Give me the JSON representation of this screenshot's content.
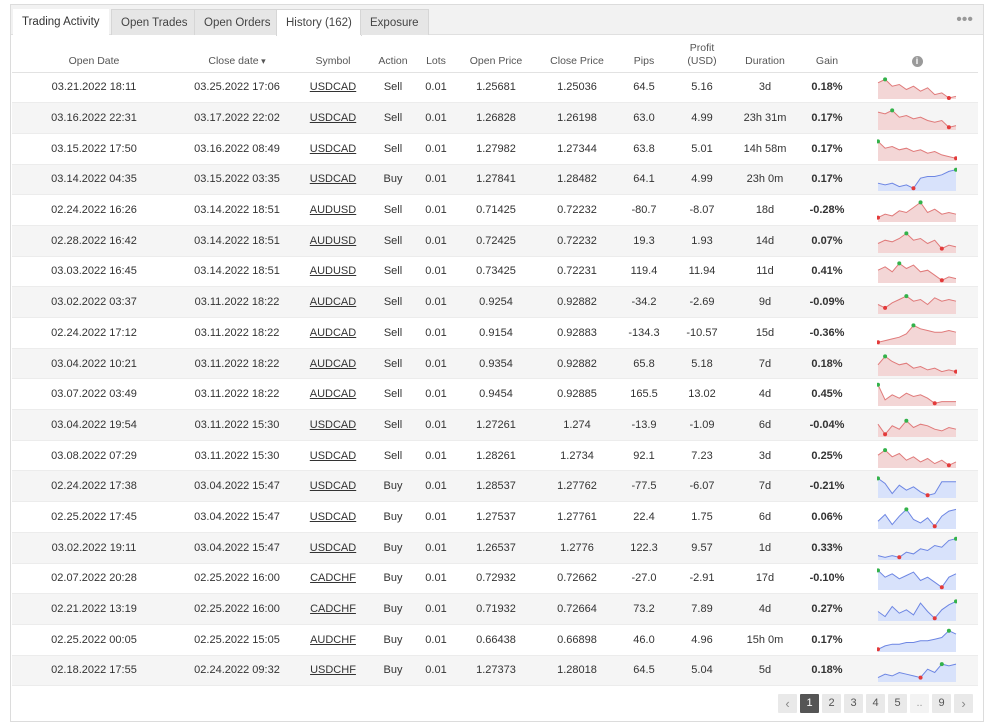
{
  "tabs": [
    {
      "label": "Trading Activity"
    },
    {
      "label": "Open Trades"
    },
    {
      "label": "Open Orders"
    },
    {
      "label": "History (162)"
    },
    {
      "label": "Exposure"
    }
  ],
  "more_icon": "ellipsis-icon",
  "columns": {
    "open_date": "Open Date",
    "close_date": "Close date",
    "symbol": "Symbol",
    "action": "Action",
    "lots": "Lots",
    "open_price": "Open Price",
    "close_price": "Close Price",
    "pips": "Pips",
    "profit_line1": "Profit",
    "profit_line2": "(USD)",
    "duration": "Duration",
    "gain": "Gain",
    "info": "i"
  },
  "rows": [
    {
      "open_date": "03.21.2022 18:11",
      "close_date": "03.25.2022 17:06",
      "symbol": "USDCAD",
      "action": "Sell",
      "lots": "0.01",
      "open_price": "1.25681",
      "close_price": "1.25036",
      "pips": "64.5",
      "profit": "5.16",
      "duration": "3d",
      "gain": "0.18%",
      "sign": "pos",
      "spark": {
        "kind": "sell",
        "pts": [
          4,
          2,
          6,
          5,
          8,
          6,
          9,
          7,
          11,
          10,
          13,
          12
        ]
      }
    },
    {
      "open_date": "03.16.2022 22:31",
      "close_date": "03.17.2022 22:02",
      "symbol": "USDCAD",
      "action": "Sell",
      "lots": "0.01",
      "open_price": "1.26828",
      "close_price": "1.26198",
      "pips": "63.0",
      "profit": "4.99",
      "duration": "23h 31m",
      "gain": "0.17%",
      "sign": "pos",
      "spark": {
        "kind": "sell",
        "pts": [
          3,
          4,
          2,
          6,
          5,
          7,
          6,
          8,
          9,
          8,
          12,
          11
        ]
      }
    },
    {
      "open_date": "03.15.2022 17:50",
      "close_date": "03.16.2022 08:49",
      "symbol": "USDCAD",
      "action": "Sell",
      "lots": "0.01",
      "open_price": "1.27982",
      "close_price": "1.27344",
      "pips": "63.8",
      "profit": "5.01",
      "duration": "14h 58m",
      "gain": "0.17%",
      "sign": "pos",
      "spark": {
        "kind": "sell",
        "pts": [
          2,
          6,
          5,
          7,
          6,
          8,
          7,
          9,
          8,
          10,
          11,
          12
        ]
      }
    },
    {
      "open_date": "03.14.2022 04:35",
      "close_date": "03.15.2022 03:35",
      "symbol": "USDCAD",
      "action": "Buy",
      "lots": "0.01",
      "open_price": "1.27841",
      "close_price": "1.28482",
      "pips": "64.1",
      "profit": "4.99",
      "duration": "23h 0m",
      "gain": "0.17%",
      "sign": "pos",
      "spark": {
        "kind": "buy",
        "pts": [
          9,
          10,
          9,
          11,
          10,
          12,
          6,
          5,
          5,
          4,
          2,
          1
        ]
      }
    },
    {
      "open_date": "02.24.2022 16:26",
      "close_date": "03.14.2022 18:51",
      "symbol": "AUDUSD",
      "action": "Sell",
      "lots": "0.01",
      "open_price": "0.71425",
      "close_price": "0.72232",
      "pips": "-80.7",
      "profit": "-8.07",
      "duration": "18d",
      "gain": "-0.28%",
      "sign": "neg",
      "spark": {
        "kind": "sell",
        "pts": [
          11,
          9,
          10,
          7,
          8,
          5,
          2,
          8,
          6,
          9,
          8,
          9
        ]
      }
    },
    {
      "open_date": "02.28.2022 16:42",
      "close_date": "03.14.2022 18:51",
      "symbol": "AUDUSD",
      "action": "Sell",
      "lots": "0.01",
      "open_price": "0.72425",
      "close_price": "0.72232",
      "pips": "19.3",
      "profit": "1.93",
      "duration": "14d",
      "gain": "0.07%",
      "sign": "pos",
      "spark": {
        "kind": "sell",
        "pts": [
          8,
          6,
          7,
          5,
          2,
          6,
          5,
          8,
          6,
          11,
          9,
          10
        ]
      }
    },
    {
      "open_date": "03.03.2022 16:45",
      "close_date": "03.14.2022 18:51",
      "symbol": "AUDUSD",
      "action": "Sell",
      "lots": "0.01",
      "open_price": "0.73425",
      "close_price": "0.72231",
      "pips": "119.4",
      "profit": "11.94",
      "duration": "11d",
      "gain": "0.41%",
      "sign": "pos",
      "spark": {
        "kind": "sell",
        "pts": [
          6,
          4,
          7,
          2,
          5,
          3,
          7,
          6,
          9,
          12,
          10,
          11
        ]
      }
    },
    {
      "open_date": "03.02.2022 03:37",
      "close_date": "03.11.2022 18:22",
      "symbol": "AUDCAD",
      "action": "Sell",
      "lots": "0.01",
      "open_price": "0.9254",
      "close_price": "0.92882",
      "pips": "-34.2",
      "profit": "-2.69",
      "duration": "9d",
      "gain": "-0.09%",
      "sign": "neg",
      "spark": {
        "kind": "sell",
        "pts": [
          8,
          10,
          7,
          5,
          3,
          6,
          5,
          8,
          4,
          6,
          5,
          6
        ]
      }
    },
    {
      "open_date": "02.24.2022 17:12",
      "close_date": "03.11.2022 18:22",
      "symbol": "AUDCAD",
      "action": "Sell",
      "lots": "0.01",
      "open_price": "0.9154",
      "close_price": "0.92883",
      "pips": "-134.3",
      "profit": "-10.57",
      "duration": "15d",
      "gain": "-0.36%",
      "sign": "neg",
      "spark": {
        "kind": "sell",
        "pts": [
          12,
          11,
          10,
          9,
          7,
          2,
          4,
          5,
          6,
          6,
          5,
          6
        ]
      }
    },
    {
      "open_date": "03.04.2022 10:21",
      "close_date": "03.11.2022 18:22",
      "symbol": "AUDCAD",
      "action": "Sell",
      "lots": "0.01",
      "open_price": "0.9354",
      "close_price": "0.92882",
      "pips": "65.8",
      "profit": "5.18",
      "duration": "7d",
      "gain": "0.18%",
      "sign": "pos",
      "spark": {
        "kind": "sell",
        "pts": [
          7,
          2,
          5,
          7,
          6,
          9,
          8,
          10,
          9,
          11,
          10,
          11
        ]
      }
    },
    {
      "open_date": "03.07.2022 03:49",
      "close_date": "03.11.2022 18:22",
      "symbol": "AUDCAD",
      "action": "Sell",
      "lots": "0.01",
      "open_price": "0.9454",
      "close_price": "0.92885",
      "pips": "165.5",
      "profit": "13.02",
      "duration": "4d",
      "gain": "0.45%",
      "sign": "pos",
      "spark": {
        "kind": "sell",
        "pts": [
          1,
          10,
          7,
          9,
          6,
          8,
          7,
          9,
          12,
          11,
          11,
          11
        ]
      }
    },
    {
      "open_date": "03.04.2022 19:54",
      "close_date": "03.11.2022 15:30",
      "symbol": "USDCAD",
      "action": "Sell",
      "lots": "0.01",
      "open_price": "1.27261",
      "close_price": "1.274",
      "pips": "-13.9",
      "profit": "-1.09",
      "duration": "6d",
      "gain": "-0.04%",
      "sign": "neg",
      "spark": {
        "kind": "sell",
        "pts": [
          6,
          12,
          7,
          9,
          4,
          8,
          6,
          7,
          9,
          10,
          8,
          9
        ]
      }
    },
    {
      "open_date": "03.08.2022 07:29",
      "close_date": "03.11.2022 15:30",
      "symbol": "USDCAD",
      "action": "Sell",
      "lots": "0.01",
      "open_price": "1.28261",
      "close_price": "1.2734",
      "pips": "92.1",
      "profit": "7.23",
      "duration": "3d",
      "gain": "0.25%",
      "sign": "pos",
      "spark": {
        "kind": "sell",
        "pts": [
          6,
          3,
          7,
          5,
          9,
          7,
          10,
          8,
          11,
          9,
          12,
          10
        ]
      }
    },
    {
      "open_date": "02.24.2022 17:38",
      "close_date": "03.04.2022 15:47",
      "symbol": "USDCAD",
      "action": "Buy",
      "lots": "0.01",
      "open_price": "1.28537",
      "close_price": "1.27762",
      "pips": "-77.5",
      "profit": "-6.07",
      "duration": "7d",
      "gain": "-0.21%",
      "sign": "neg",
      "spark": {
        "kind": "buy",
        "pts": [
          2,
          5,
          11,
          6,
          9,
          7,
          10,
          12,
          11,
          4,
          4,
          4
        ]
      }
    },
    {
      "open_date": "02.25.2022 17:45",
      "close_date": "03.04.2022 15:47",
      "symbol": "USDCAD",
      "action": "Buy",
      "lots": "0.01",
      "open_price": "1.27537",
      "close_price": "1.27761",
      "pips": "22.4",
      "profit": "1.75",
      "duration": "6d",
      "gain": "0.06%",
      "sign": "pos",
      "spark": {
        "kind": "buy",
        "pts": [
          9,
          5,
          11,
          6,
          2,
          8,
          10,
          7,
          12,
          6,
          3,
          2
        ]
      }
    },
    {
      "open_date": "03.02.2022 19:11",
      "close_date": "03.04.2022 15:47",
      "symbol": "USDCAD",
      "action": "Buy",
      "lots": "0.01",
      "open_price": "1.26537",
      "close_price": "1.2776",
      "pips": "122.3",
      "profit": "9.57",
      "duration": "1d",
      "gain": "0.33%",
      "sign": "pos",
      "spark": {
        "kind": "buy",
        "pts": [
          11,
          12,
          11,
          12,
          9,
          10,
          7,
          8,
          5,
          6,
          2,
          1
        ]
      }
    },
    {
      "open_date": "02.07.2022 20:28",
      "close_date": "02.25.2022 16:00",
      "symbol": "CADCHF",
      "action": "Buy",
      "lots": "0.01",
      "open_price": "0.72932",
      "close_price": "0.72662",
      "pips": "-27.0",
      "profit": "-2.91",
      "duration": "17d",
      "gain": "-0.10%",
      "sign": "neg",
      "spark": {
        "kind": "buy",
        "pts": [
          2,
          6,
          4,
          7,
          5,
          3,
          8,
          6,
          9,
          12,
          6,
          4
        ]
      }
    },
    {
      "open_date": "02.21.2022 13:19",
      "close_date": "02.25.2022 16:00",
      "symbol": "CADCHF",
      "action": "Buy",
      "lots": "0.01",
      "open_price": "0.71932",
      "close_price": "0.72664",
      "pips": "73.2",
      "profit": "7.89",
      "duration": "4d",
      "gain": "0.27%",
      "sign": "pos",
      "spark": {
        "kind": "buy",
        "pts": [
          8,
          11,
          5,
          9,
          7,
          10,
          3,
          8,
          12,
          7,
          4,
          2
        ]
      }
    },
    {
      "open_date": "02.25.2022 00:05",
      "close_date": "02.25.2022 15:05",
      "symbol": "AUDCHF",
      "action": "Buy",
      "lots": "0.01",
      "open_price": "0.66438",
      "close_price": "0.66898",
      "pips": "46.0",
      "profit": "4.96",
      "duration": "15h 0m",
      "gain": "0.17%",
      "sign": "pos",
      "spark": {
        "kind": "buy",
        "pts": [
          12,
          10,
          9,
          9,
          8,
          8,
          7,
          7,
          6,
          5,
          1,
          3
        ]
      }
    },
    {
      "open_date": "02.18.2022 17:55",
      "close_date": "02.24.2022 09:32",
      "symbol": "USDCHF",
      "action": "Buy",
      "lots": "0.01",
      "open_price": "1.27373",
      "close_price": "1.28018",
      "pips": "64.5",
      "profit": "5.04",
      "duration": "5d",
      "gain": "0.18%",
      "sign": "pos",
      "spark": {
        "kind": "buy",
        "pts": [
          11,
          9,
          10,
          8,
          9,
          10,
          11,
          6,
          8,
          3,
          4,
          3
        ]
      }
    }
  ],
  "pagination": {
    "prev": "‹",
    "pages": [
      "1",
      "2",
      "3",
      "4",
      "5",
      "..",
      "9"
    ],
    "active": "1",
    "next": "›"
  },
  "colors": {
    "positive": "#2aa12a",
    "negative": "#e04444",
    "sell_fill": "#f3d6d6",
    "sell_line": "#e07a7a",
    "buy_fill": "#d8e2fb",
    "buy_line": "#6d86e3",
    "marker_high": "#33b24a",
    "marker_low": "#e33a3a"
  }
}
